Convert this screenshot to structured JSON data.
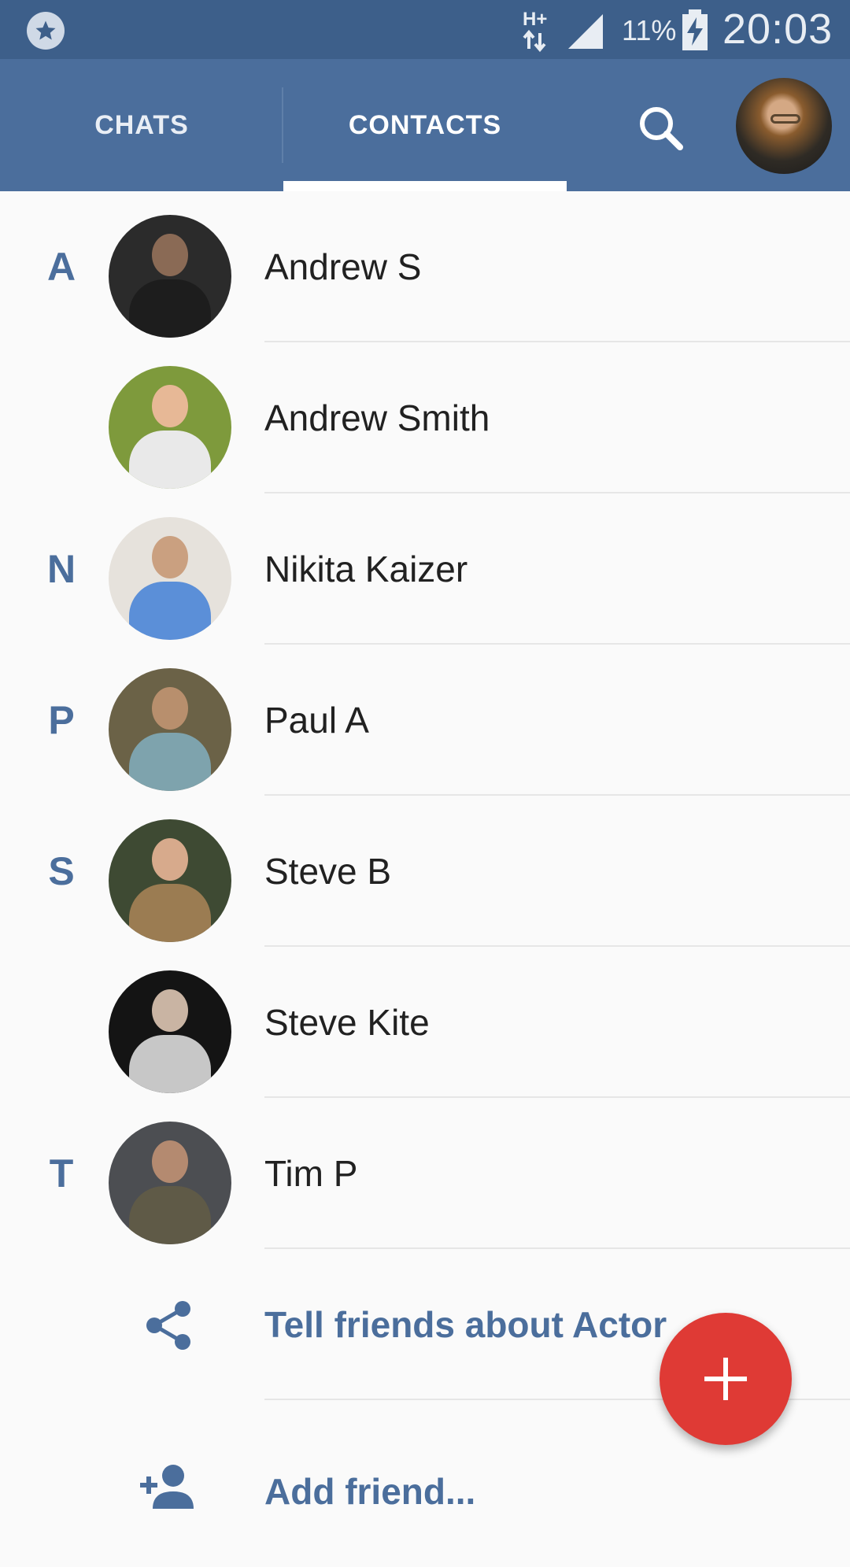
{
  "status_bar": {
    "network": "H+",
    "battery_percent": "11%",
    "time": "20:03"
  },
  "app_bar": {
    "tabs": [
      {
        "label": "CHATS",
        "selected": false
      },
      {
        "label": "CONTACTS",
        "selected": true
      }
    ],
    "search_icon": "search-icon",
    "profile_icon": "profile-avatar"
  },
  "contacts": [
    {
      "section": "A",
      "name": "Andrew S"
    },
    {
      "section": "",
      "name": "Andrew Smith"
    },
    {
      "section": "N",
      "name": "Nikita Kaizer"
    },
    {
      "section": "P",
      "name": "Paul A"
    },
    {
      "section": "S",
      "name": "Steve B"
    },
    {
      "section": "",
      "name": "Steve Kite"
    },
    {
      "section": "T",
      "name": "Tim P"
    }
  ],
  "actions": {
    "share_label": "Tell friends about Actor",
    "add_friend_label": "Add friend..."
  },
  "fab": {
    "icon": "plus-icon"
  },
  "colors": {
    "primary": "#4b6e9c",
    "status_bar": "#3d5f8a",
    "accent": "#df3a35"
  }
}
